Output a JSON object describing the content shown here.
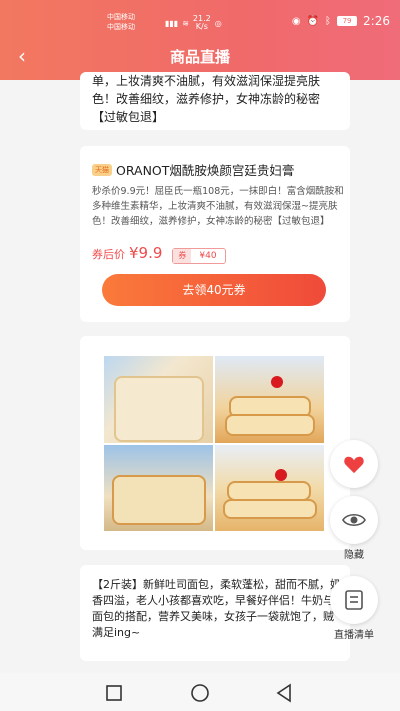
{
  "status": {
    "carrier1": "中国移动",
    "carrier2": "中国移动",
    "speed": "21.2",
    "speed_unit": "K/s",
    "battery": "79",
    "time": "2:26"
  },
  "header": {
    "back_icon": "chevron-left-icon",
    "title": "商品直播"
  },
  "card1": {
    "desc": "单，上妆清爽不油腻，有效滋润保湿提亮肤色！改善细纹，滋养修护，女神冻龄的秘密【过敏包退】"
  },
  "card2": {
    "badge": "天猫",
    "title": "ORANOT烟酰胺焕颜宫廷贵妇膏",
    "desc": "秒杀价9.9元！屈臣氏一瓶108元，一抹即白！富含烟酰胺和多种维生素精华，上妆清爽不油腻，有效滋润保湿~提亮肤色！改善细纹，滋养修护，女神冻龄的秘密【过敏包退】",
    "price_label": "券后价",
    "price": "¥9.9",
    "coupon_tag": "券",
    "coupon_value": "¥40",
    "button": "去领40元券"
  },
  "card4": {
    "desc": "【2斤装】新鲜吐司面包，柔软蓬松，甜而不腻，奶香四溢，老人小孩都喜欢吃，早餐好伴侣！牛奶与面包的搭配，营养又美味，女孩子一袋就饱了，贼满足ing~"
  },
  "side": {
    "like_icon": "heart-icon",
    "hide_icon": "eye-icon",
    "hide_label": "隐藏",
    "list_icon": "list-icon",
    "list_label": "直播清单"
  },
  "colors": {
    "accent": "#ee4b4b",
    "header_start": "#f2785f",
    "header_end": "#ef6c79"
  }
}
